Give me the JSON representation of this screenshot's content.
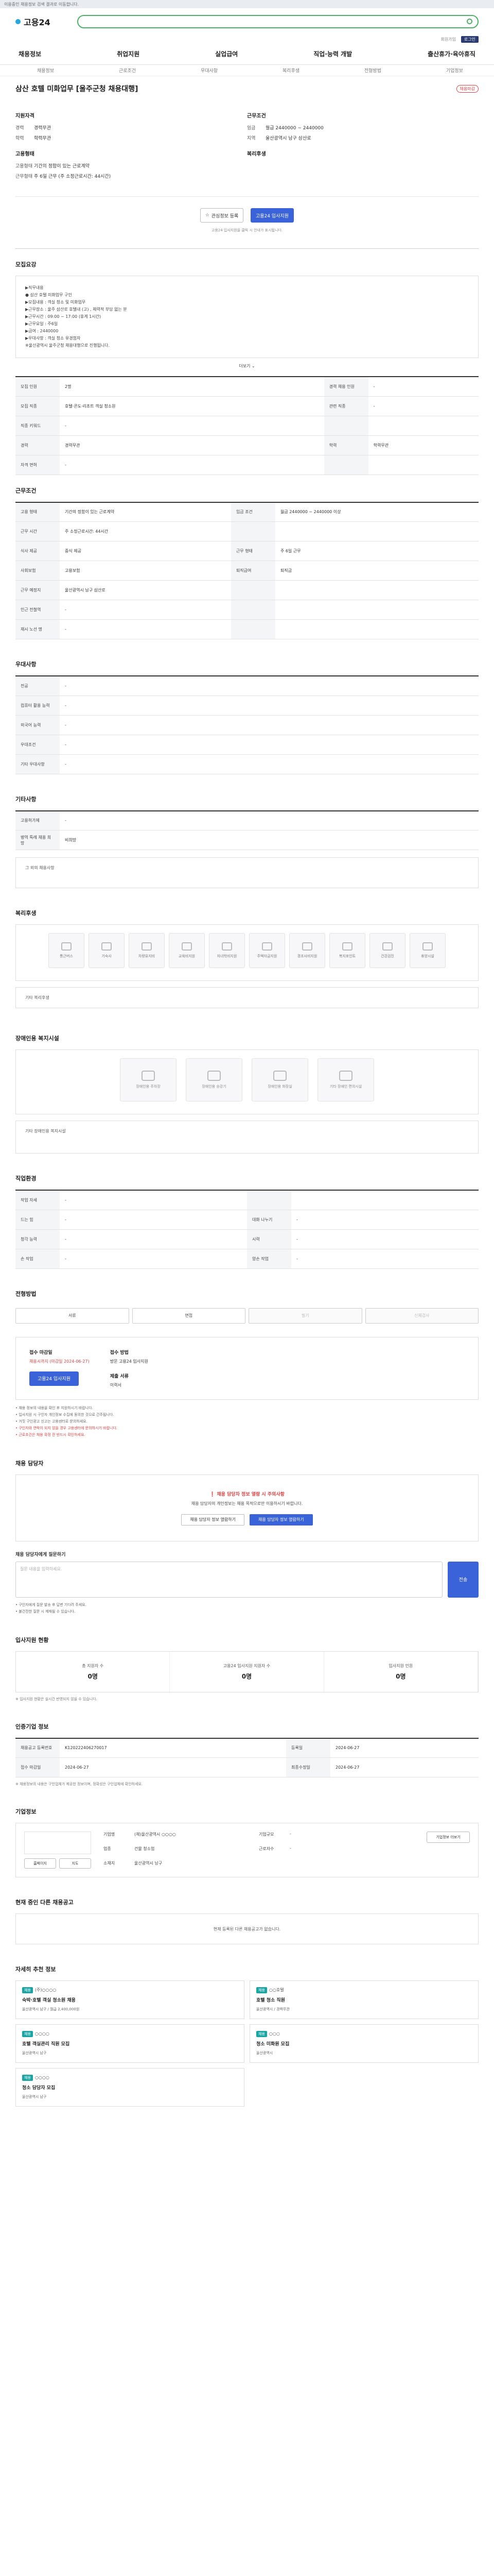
{
  "topbar": {
    "notice": "이용중인 채용정보 검색 결과로 이동합니다."
  },
  "header": {
    "logo": "고용24",
    "util_login": "로그인",
    "util_join": "회원가입",
    "util_map": "전체메뉴"
  },
  "gnb": [
    "채용정보",
    "취업지원",
    "실업급여",
    "직업·능력 개발",
    "출산휴가·육아휴직"
  ],
  "subnav": [
    "채용정보",
    "근로조건",
    "우대사항",
    "복리후생",
    "전형방법",
    "기업정보"
  ],
  "job": {
    "title": "삼산 호텔 미화업무 [울주군청 채용대행]",
    "badge": "채용마감",
    "left_h": "지원자격",
    "left": [
      [
        "경력",
        "경력무관"
      ],
      [
        "학력",
        "학력무관"
      ]
    ],
    "left2_h": "고용형태",
    "left2": [
      [
        "고용형태",
        "기간의 정함이 있는 근로계약"
      ],
      [
        "근무형태",
        "주 6일 근무 (주 소정근로시간: 44시간)"
      ]
    ],
    "right_h": "근무조건",
    "right": [
      [
        "임금",
        "월급 2440000 ~ 2440000"
      ],
      [
        "지역",
        "울산광역시 남구 삼산로"
      ]
    ],
    "right2_h": "복리후생",
    "btn_scrap": "관심정보 등록",
    "btn_apply": "고용24 입사지원",
    "notice": "고용24 입사지원을 클릭 시 안내가 표시됩니다."
  },
  "sections": {
    "intro": "모집요강",
    "cond": "근무조건",
    "pref": "우대사항",
    "etc": "기타사항",
    "welfare": "복리후생",
    "disabled": "장애인용 복지시설",
    "jobinfo": "직업환경",
    "process": "전형방법",
    "apply_method": "채용 담당자",
    "stats": "입사지원 현황",
    "manager": "인증기업 정보",
    "company": "기업정보",
    "others": "현재 중인 다른 채용공고",
    "recommend": "자세히 추천 정보"
  },
  "intro": {
    "lines": [
      "▶직무내용",
      "● 삼산 호텔 미화업무 구인",
      "▶모집내용 : 객실 청소 및 미화업무",
      "▶근무장소 : 울주 삼산로 호텔내 (고) , 체력적 부담 없는 분",
      "▶근무시간 : 09:00 ~ 17:00 (휴게 1시간)",
      "▶근무요일 : 주6일",
      "▶급여 : 2440000",
      "▶우대사항 : 객실 청소 유경험자",
      "※울산광역시 울주군청 채용대행으로 진행됩니다."
    ],
    "more": "더보기"
  },
  "intro_table": [
    [
      "모집 인원",
      "2명",
      "경력 채용 인원",
      "-"
    ],
    [
      "모집 직종",
      "호텔·콘도·리조트 객실 청소원",
      "관련 직종",
      "-"
    ],
    [
      "직종 키워드",
      "-",
      "",
      ""
    ],
    [
      "경력",
      "경력무관",
      "학력",
      "학력무관"
    ],
    [
      "자격 면허",
      "-",
      "",
      ""
    ]
  ],
  "cond_table": [
    [
      "고용 형태",
      "기간의 정함이 있는 근로계약",
      "임금 조건",
      "월급 2440000 ~ 2440000 이상"
    ],
    [
      "근무 시간",
      "주 소정근로시간: 44시간",
      "",
      ""
    ],
    [
      "식사 제공",
      "중식 제공",
      "근무 형태",
      "주 6일 근무"
    ],
    [
      "사회보험",
      "고용보험",
      "퇴직급여",
      "퇴직금"
    ],
    [
      "근무 예정지",
      "울산광역시 남구 삼산로",
      "",
      ""
    ],
    [
      "인근 전철역",
      "-",
      "",
      ""
    ],
    [
      "재시 노선 명",
      "-",
      "",
      ""
    ]
  ],
  "pref_table": [
    [
      "전공",
      "-"
    ],
    [
      "컴퓨터 활용 능력",
      "-"
    ],
    [
      "외국어 능력",
      "-"
    ],
    [
      "우대조건",
      "-"
    ],
    [
      "기타 우대사항",
      "-"
    ]
  ],
  "etc_table": [
    [
      "고용허가제",
      "-"
    ],
    [
      "병역 특례 채용 희망",
      "비희망"
    ]
  ],
  "etc_note": "그 외의 채용사항",
  "welfare_cards": [
    "통근버스",
    "기숙사",
    "차량유지비",
    "교육비지원",
    "자녀학비지원",
    "주택자금지원",
    "경조사비지원",
    "복지포인트",
    "건강검진",
    "휴양시설"
  ],
  "welfare_note": "기타 복리후생",
  "disabled_cards": [
    "장애인용 주차장",
    "장애인용 승강기",
    "장애인용 화장실",
    "기타 장애인 편의시설"
  ],
  "disabled_note": "기타 장애인용 복지시설",
  "job_table": [
    [
      "작업 자세",
      "-",
      "",
      ""
    ],
    [
      "드는 힘",
      "-",
      "대화 나누기",
      "-"
    ],
    [
      "청각 능력",
      "-",
      "시력",
      "-"
    ],
    [
      "손 작업",
      "-",
      "양손 작업",
      "-"
    ]
  ],
  "process": [
    "서류",
    "면접",
    "필기",
    "신체검사"
  ],
  "apply": {
    "h1": "접수 마감일",
    "v1": "채용시까지 (마감일 2024-06-27)",
    "h2": "접수 방법",
    "v2": "방문 고용24 입사지원",
    "btn": "고용24 입사지원",
    "h3": "제출 서류",
    "v3": "이력서",
    "bullets": [
      "채용 정보의 내용을 확인 후 지원하시기 바랍니다.",
      "입사지원 시 구인자 개인정보 수집에 동의한 것으로 간주됩니다.",
      "거짓 구인광고 신고는 고용센터로 문의하세요.",
      "구인자와 연락이 되지 않을 경우 고용센터에 문의하시기 바랍니다.",
      "근로조건은 채용 확정 전 반드시 확인하세요."
    ]
  },
  "manager": {
    "alert": "채용 담당자 정보 열람 시 주의사항",
    "desc": "채용 담당자의 개인정보는 채용 목적으로만 이용하시기 바랍니다.",
    "btn1": "채용 담당자 정보 열람하기",
    "btn2": "채용 담당자 정보 열람하기",
    "q_h": "채용 담당자에게 질문하기",
    "q_ph": "질문 내용을 입력하세요.",
    "q_btn": "전송",
    "notes": [
      "구인자에게 질문 발송 후 답변 기다려 주세요.",
      "불건전한 질문 시 제재될 수 있습니다."
    ]
  },
  "stats": [
    [
      "총 지원자 수",
      "0명"
    ],
    [
      "고용24 입사지원 지원자 수",
      "0명"
    ],
    [
      "입사지원 인원",
      "0명"
    ]
  ],
  "stats_note": "※ 입사지원 현황은 실시간 반영되지 않을 수 있습니다.",
  "cert_table": [
    [
      "채용공고 등록번호",
      "K120222406270017",
      "등록일",
      "2024-06-27"
    ],
    [
      "접수 마감일",
      "2024-06-27",
      "최종수정일",
      "2024-06-27"
    ]
  ],
  "cert_note": "※ 채용정보의 내용은 구인업체가 제공한 정보이며, 정확성은 구인업체에 확인하세요.",
  "company": {
    "name_k": "기업명",
    "name": "(재)울산광역시 ○○○○",
    "ind_k": "업종",
    "ind": "건물 청소업",
    "size_k": "기업규모",
    "size": "-",
    "emp_k": "근로자수",
    "emp": "-",
    "addr_k": "소재지",
    "addr": "울산광역시 남구",
    "btn": "기업정보 더보기",
    "home": "홈페이지",
    "map": "지도"
  },
  "others_note": "현재 등록된 다른 채용공고가 없습니다.",
  "recommend": [
    {
      "c": "(주)○○○○",
      "t": "숙박·호텔 객실 청소원 채용",
      "m": "울산광역시 남구 / 월급 2,400,000원"
    },
    {
      "c": "○○호텔",
      "t": "호텔 청소 직원",
      "m": "울산광역시 / 경력무관"
    },
    {
      "c": "○○○○",
      "t": "호텔 객실관리 직원 모집",
      "m": "울산광역시 남구"
    },
    {
      "c": "○○○",
      "t": "청소 미화원 모집",
      "m": "울산광역시"
    },
    {
      "c": "○○○○",
      "t": "청소 담당자 모집",
      "m": "울산광역시 남구"
    }
  ]
}
